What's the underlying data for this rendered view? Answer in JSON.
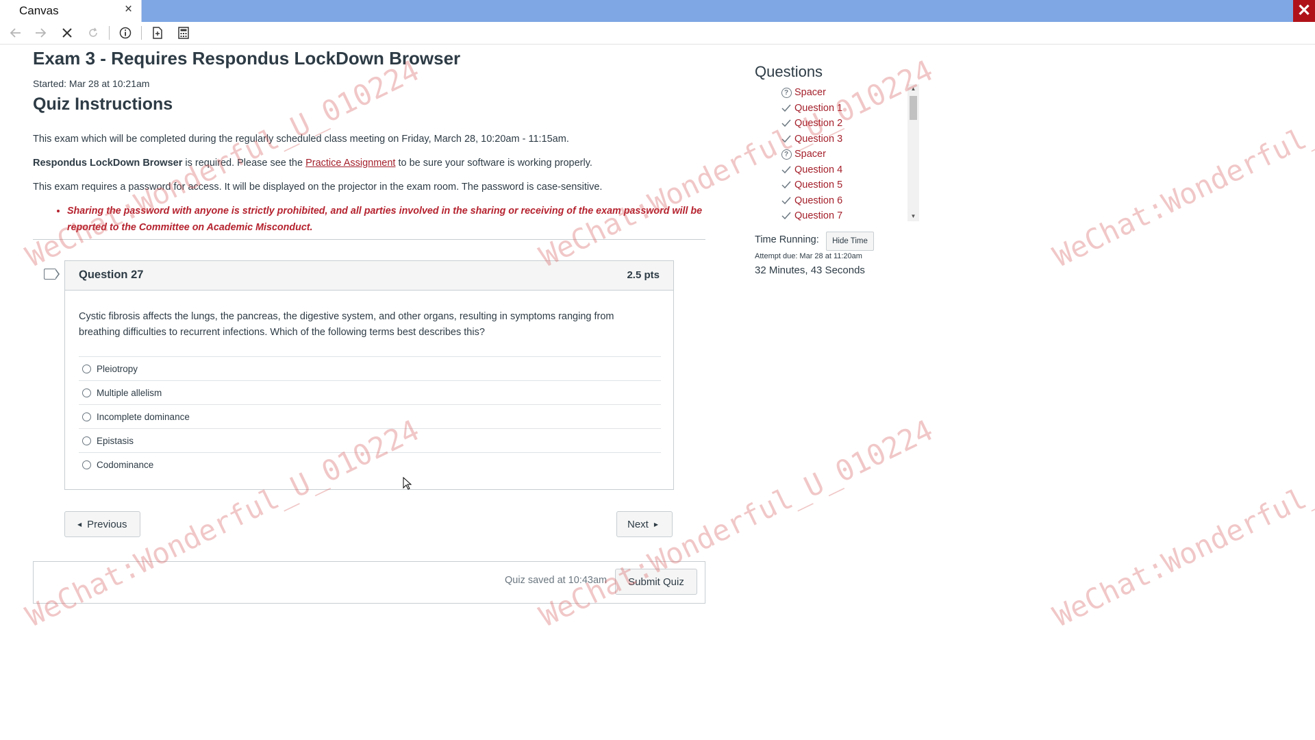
{
  "browser": {
    "tab_title": "Canvas",
    "tab_close": "×",
    "window_close": "✕",
    "toolbar_icons": [
      "back-arrow-icon",
      "forward-arrow-icon",
      "stop-icon",
      "reload-icon",
      "info-icon",
      "document-icon",
      "calculator-icon"
    ]
  },
  "quiz": {
    "title": "Exam 3 - Requires Respondus LockDown Browser",
    "started": "Started: Mar 28 at 10:21am",
    "instructions_title": "Quiz Instructions",
    "para1": "This exam which will be completed during the regularly scheduled class meeting on Friday, March 28, 10:20am - 11:15am.",
    "para2_bold": "Respondus LockDown Browser",
    "para2_mid": " is required. Please see the ",
    "para2_link": "Practice Assignment",
    "para2_end": " to be sure your software is working properly.",
    "para3": "This exam requires a password for access. It will be displayed on the projector in the exam room. The password is case-sensitive.",
    "warning": "Sharing the password with anyone is strictly prohibited, and all parties involved in the sharing or receiving of the exam password will be reported to the Committee on Academic Misconduct."
  },
  "question": {
    "title": "Question 27",
    "points": "2.5 pts",
    "text": "Cystic fibrosis affects the lungs, the pancreas, the digestive system, and other organs, resulting in symptoms ranging from breathing difficulties to recurrent infections. Which of the following terms best describes this?",
    "answers": [
      "Pleiotropy",
      "Multiple allelism",
      "Incomplete dominance",
      "Epistasis",
      "Codominance"
    ]
  },
  "nav": {
    "previous": "Previous",
    "next": "Next"
  },
  "footer": {
    "saved": "Quiz saved at 10:43am",
    "submit": "Submit Quiz"
  },
  "sidebar": {
    "heading": "Questions",
    "items": [
      {
        "label": "Spacer",
        "status": "unanswered"
      },
      {
        "label": "Question 1",
        "status": "answered"
      },
      {
        "label": "Question 2",
        "status": "answered"
      },
      {
        "label": "Question 3",
        "status": "answered"
      },
      {
        "label": "Spacer",
        "status": "unanswered"
      },
      {
        "label": "Question 4",
        "status": "answered"
      },
      {
        "label": "Question 5",
        "status": "answered"
      },
      {
        "label": "Question 6",
        "status": "answered"
      },
      {
        "label": "Question 7",
        "status": "answered"
      }
    ],
    "time_label": "Time Running:",
    "hide_time": "Hide Time",
    "attempt_due": "Attempt due: Mar 28 at 11:20am",
    "time_value": "32 Minutes, 43 Seconds"
  },
  "watermark": "WeChat:Wonderful_U_010224",
  "colors": {
    "titlebar": "#7ea7e3",
    "link": "#a4202b",
    "warning": "#b5232f",
    "close_button": "#b0121a"
  }
}
